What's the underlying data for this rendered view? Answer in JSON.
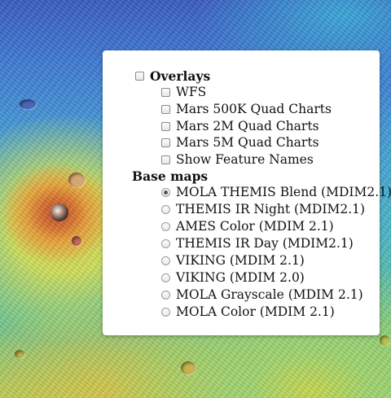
{
  "map": {
    "description_layer": "MOLA THEMIS Blend (MDIM2.1)"
  },
  "layer_control": {
    "overlays": {
      "label": "Overlays",
      "checked": false,
      "items": [
        {
          "label": "WFS",
          "checked": false
        },
        {
          "label": "Mars 500K Quad Charts",
          "checked": false
        },
        {
          "label": "Mars 2M Quad Charts",
          "checked": false
        },
        {
          "label": "Mars 5M Quad Charts",
          "checked": false
        },
        {
          "label": "Show Feature Names",
          "checked": false
        }
      ]
    },
    "base_maps": {
      "label": "Base maps",
      "items": [
        {
          "label": "MOLA THEMIS Blend (MDIM2.1)",
          "selected": true
        },
        {
          "label": "THEMIS IR Night (MDIM2.1)",
          "selected": false
        },
        {
          "label": "AMES Color (MDIM 2.1)",
          "selected": false
        },
        {
          "label": "THEMIS IR Day (MDIM2.1)",
          "selected": false
        },
        {
          "label": "VIKING (MDIM 2.1)",
          "selected": false
        },
        {
          "label": "VIKING (MDIM 2.0)",
          "selected": false
        },
        {
          "label": "MOLA Grayscale (MDIM 2.1)",
          "selected": false
        },
        {
          "label": "MOLA Color (MDIM 2.1)",
          "selected": false
        }
      ]
    }
  }
}
